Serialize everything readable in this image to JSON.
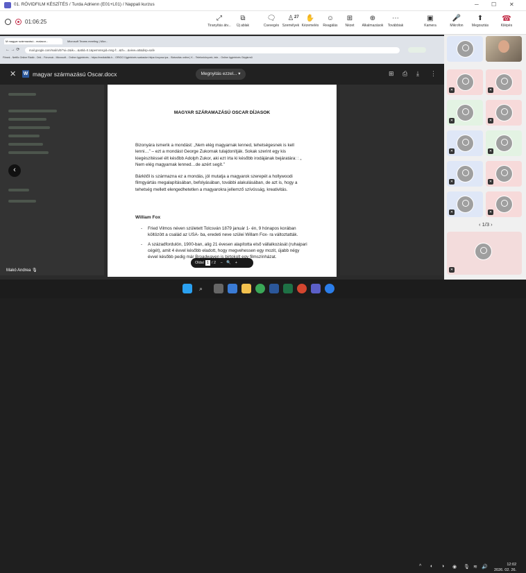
{
  "window": {
    "title": "01. RÖVIDFILM KÉSZÍTÉS / Turda Adrienn (E01+L01) / Nappali kurzus"
  },
  "meeting": {
    "timer": "01:06:25",
    "participants_count": "27",
    "toolbar": [
      {
        "label": "Tiranyítás átv...",
        "icon": "share-control-icon",
        "glyph": "⤢"
      },
      {
        "label": "Új ablak",
        "icon": "new-window-icon",
        "glyph": "⧉"
      },
      {
        "label": "Csevegés",
        "icon": "chat-icon",
        "glyph": "💬"
      },
      {
        "label": "Személyek",
        "icon": "people-icon",
        "glyph": "👥"
      },
      {
        "label": "Kézemelés",
        "icon": "raise-hand-icon",
        "glyph": "✋"
      },
      {
        "label": "Reagálás",
        "icon": "react-icon",
        "glyph": "☺"
      },
      {
        "label": "Nézet",
        "icon": "view-icon",
        "glyph": "⊞"
      },
      {
        "label": "Alkalmazások",
        "icon": "apps-icon",
        "glyph": "⊕"
      },
      {
        "label": "Továbbiak",
        "icon": "more-icon",
        "glyph": "⋯"
      },
      {
        "label": "Kamera",
        "icon": "camera-icon",
        "glyph": "📷"
      },
      {
        "label": "Mikrofon",
        "icon": "microphone-icon",
        "glyph": "🎙"
      },
      {
        "label": "Megosztás",
        "icon": "share-icon",
        "glyph": "⬆"
      },
      {
        "label": "Kilépés",
        "icon": "leave-icon",
        "glyph": "☎"
      }
    ]
  },
  "browser": {
    "tab1": "M magyar származású - malacor...",
    "tab2": "Microsoft Teams meeting | Micr...",
    "url": "mail.google.com/mail/u/0/?ui=2&ik=...&attid=0.1&permmsgid=msg-f:...&th=...&view=att&disp=safe",
    "bookmarks": "Filmek - Netflix   Online Rádió - Onli...   Fórumok - Microsoft...   Online ügyintézés...   https://mediaklikk.h...   ORIGO   Ügyintézés szabadon   https://zoyosz.ipa...   Biztosítás online | K...   Telefonkönyvek, tele...   Online ügyintézés   Gépjármű"
  },
  "viewer": {
    "filename": "magyar származású Oscar.docx",
    "open_with": "Megnyitás ezzel...",
    "page_label": "Oldal",
    "page_current": "1",
    "page_sep": "/",
    "page_total": "2"
  },
  "document": {
    "title": "MAGYAR SZÁRAMAZÁSÚ OSCAR DÍJASOK",
    "para1": "Bizonyára ismerik a mondást: „Nem elég magyarnak lenned, tehetségesnek is kell lenni…” – ezt  a mondást George Zukornak tulajdonítják. Sokak szerint egy kis kiegészítéssel  élt később Adolph Zukor, aki ezt írta ki később irodájának bejáratára: : „ Nem elég magyarnak lenned…de azért segít.”",
    "para2": "Bárkitől is származna ez a mondás, jól mutatja a magyarok szerepét a hollywoodi filmgyártás megalapításában, befolyásában, további alakulásában, de azt is, hogy a tehetség mellett elengedhetetlen a magyarokra jellemző szívósság, kreativitás.",
    "section": "William Fox",
    "bullets": [
      "Fried Vilmos néven született Tolcsván 1879 január 1- én, 9 hónapos korában költözött a család az USA- ba, eredeti neve szülei Willam Fox- ra változtatták.",
      "A századfordulón, 1900-ban, alig 21 évesen alapította első vállalkozását (ruhaipari cégét), amit 4 évvel később eladott, hogy megvehessen egy mozit, újabb négy évvel később pedig már Broadwayen is birtokolt egy filmszínházat."
    ]
  },
  "presenter": {
    "name": "Makó Andrea"
  },
  "gallery": {
    "pager": "1/3"
  },
  "taskbar": {
    "time": "12:02",
    "date": "2026. 02. 26."
  },
  "colors": {
    "accent": "#5b5fc7",
    "leave": "#c4314b",
    "word": "#2b579a"
  }
}
